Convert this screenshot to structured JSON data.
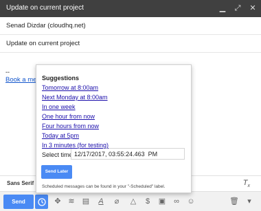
{
  "window": {
    "title": "Update on current project"
  },
  "titlebar_icons": [
    "minimize-icon",
    "expand-icon",
    "close-icon"
  ],
  "compose": {
    "recipient": "Senad Dizdar (cloudhq.net)",
    "subject": "Update on current project",
    "signature_dash": "--",
    "signature_link": "Book a meet"
  },
  "popup": {
    "heading": "Suggestions",
    "suggestions": [
      "Tomorrow at 8:00am",
      "Next Monday at 8:00am",
      "In one week",
      "One hour from now",
      "Four hours from now",
      "Today at 5pm",
      "In 3 minutes (for testing)"
    ],
    "select_time_label": "Select time:",
    "select_time_value": "12/17/2017, 03:55:24.463  PM",
    "send_later_label": "Send Later",
    "note": "Scheduled messages can be found in your \"-Scheduled\" label."
  },
  "format_bar": {
    "font": "Sans Serif",
    "clear_format_icon": "clear-formatting-icon"
  },
  "toolbar": {
    "send_label": "Send",
    "icons": [
      "schedule-clock-icon",
      "drag-icon",
      "wifi-icon",
      "template-icon",
      "text-format-icon",
      "attach-icon",
      "drive-icon",
      "money-icon",
      "photo-icon",
      "link-icon",
      "emoji-icon",
      "trash-icon",
      "more-options-icon"
    ],
    "accent_color": "#4a8af4"
  }
}
